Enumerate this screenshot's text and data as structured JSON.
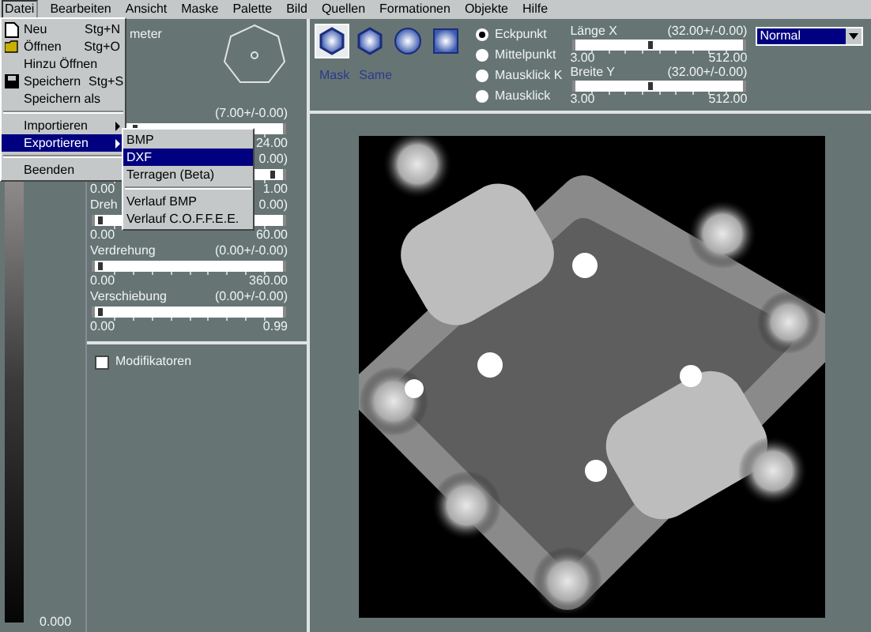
{
  "menu_bar": [
    {
      "label": "Datei",
      "selected": true
    },
    {
      "label": "Bearbeiten",
      "selected": false
    },
    {
      "label": "Ansicht",
      "selected": false
    },
    {
      "label": "Maske",
      "selected": false
    },
    {
      "label": "Palette",
      "selected": false
    },
    {
      "label": "Bild",
      "selected": false
    },
    {
      "label": "Quellen",
      "selected": false
    },
    {
      "label": "Formationen",
      "selected": false
    },
    {
      "label": "Objekte",
      "selected": false
    },
    {
      "label": "Hilfe",
      "selected": false
    }
  ],
  "file_menu": [
    {
      "kind": "item",
      "label": "Neu",
      "shortcut": "Stg+N",
      "selected": false
    },
    {
      "kind": "item",
      "label": "Öffnen",
      "shortcut": "Stg+O",
      "selected": false
    },
    {
      "kind": "item",
      "label": "Hinzu Öffnen",
      "selected": false
    },
    {
      "kind": "item",
      "label": "Speichern",
      "shortcut": "Stg+S",
      "selected": false
    },
    {
      "kind": "item",
      "label": "Speichern als",
      "selected": false
    },
    {
      "kind": "separator"
    },
    {
      "kind": "submenu",
      "label": "Importieren",
      "selected": false
    },
    {
      "kind": "submenu",
      "label": "Exportieren",
      "selected": true
    },
    {
      "kind": "separator"
    },
    {
      "kind": "item",
      "label": "Beenden",
      "selected": false
    }
  ],
  "export_submenu": [
    {
      "kind": "item",
      "label": "BMP",
      "selected": false
    },
    {
      "kind": "item",
      "label": "DXF",
      "selected": true
    },
    {
      "kind": "item",
      "label": "Terragen (Beta)",
      "selected": false
    },
    {
      "kind": "separator"
    },
    {
      "kind": "item",
      "label": "Verlauf BMP",
      "selected": false
    },
    {
      "kind": "item",
      "label": "Verlauf C.O.F.F.E.E.",
      "selected": false
    }
  ],
  "gradient_bar": {
    "reading": "0.000"
  },
  "parameter_panel": {
    "title": "meter",
    "sliders": [
      {
        "reading": "(7.00+/-0.00)",
        "max": "24.00",
        "level": 0.22
      },
      {
        "reading": "0.00)",
        "min": "0.00",
        "max": "1.00",
        "level": 0.95
      },
      {
        "label": "Dreh",
        "reading": "0.00)",
        "min": "0.00",
        "max": "60.00",
        "level": 0.03
      },
      {
        "label": "Verdrehung",
        "reading": "(0.00+/-0.00)",
        "min": "0.00",
        "max": "360.00",
        "level": 0.03
      },
      {
        "label": "Verschiebung",
        "reading": "(0.00+/-0.00)",
        "min": "0.00",
        "max": "0.99",
        "level": 0.03
      }
    ]
  },
  "modifiers": {
    "label": "Modifikatoren",
    "checked": false
  },
  "toolbar": {
    "shape_tools": [
      {
        "selected": true
      },
      {
        "selected": false
      },
      {
        "selected": false
      },
      {
        "selected": false
      }
    ],
    "tool_labels": [
      "Mask",
      "Same"
    ],
    "anchor_options": [
      {
        "label": "Eckpunkt",
        "selected": true
      },
      {
        "label": "Mittelpunkt",
        "selected": false
      },
      {
        "label": "Mausklick K",
        "selected": false
      },
      {
        "label": "Mausklick",
        "selected": false
      }
    ],
    "size_sliders": [
      {
        "label": "Länge X",
        "reading": "(32.00+/-0.00)",
        "min": "3.00",
        "max": "512.00",
        "level": 0.46
      },
      {
        "label": "Breite Y",
        "reading": "(32.00+/-0.00)",
        "min": "3.00",
        "max": "512.00",
        "level": 0.46
      }
    ],
    "blend_mode": "Normal"
  }
}
